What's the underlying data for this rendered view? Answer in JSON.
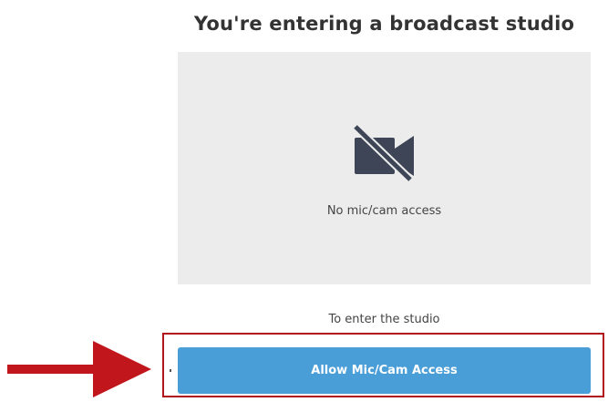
{
  "page": {
    "title": "You're entering a broadcast studio"
  },
  "preview": {
    "icon": "camera-off-icon",
    "status_text": "No mic/cam access",
    "background_color": "#ececec"
  },
  "prompt": {
    "text": "To enter the studio"
  },
  "action": {
    "allow_label": "Allow Mic/Cam Access",
    "button_color": "#4a9ed8"
  },
  "annotation": {
    "highlight_color": "#b0151b",
    "arrow_color": "#c0161c",
    "arrow_icon": "arrow-right-icon"
  }
}
